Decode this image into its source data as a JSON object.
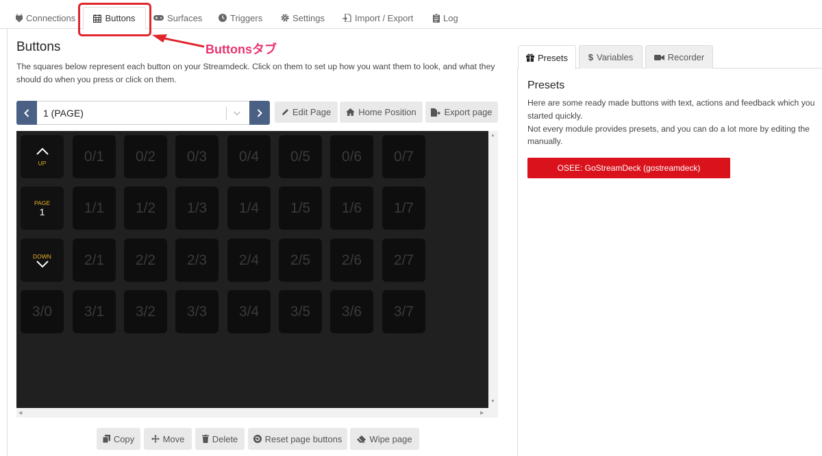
{
  "top_tabs": [
    {
      "label": "Connections",
      "icon": "plug-icon"
    },
    {
      "label": "Buttons",
      "icon": "calendar-grid-icon",
      "active": true
    },
    {
      "label": "Surfaces",
      "icon": "gamepad-icon"
    },
    {
      "label": "Triggers",
      "icon": "clock-icon"
    },
    {
      "label": "Settings",
      "icon": "gear-icon"
    },
    {
      "label": "Import / Export",
      "icon": "import-export-icon"
    },
    {
      "label": "Log",
      "icon": "clipboard-icon"
    }
  ],
  "annotation": {
    "label": "Buttonsタブ",
    "color": "#e8336d",
    "box_color": "#e0252b"
  },
  "buttons_panel": {
    "title": "Buttons",
    "description": "The squares below represent each button on your Streamdeck. Click on them to set up how you want them to look, and what they should do when you press or click on them.",
    "page_select": {
      "value": "1 (PAGE)"
    },
    "toolbar": {
      "edit_page": "Edit Page",
      "home_position": "Home Position",
      "export_page": "Export page"
    },
    "grid": {
      "rows": [
        [
          "UP",
          "0/1",
          "0/2",
          "0/3",
          "0/4",
          "0/5",
          "0/6",
          "0/7"
        ],
        [
          "PAGE",
          "1/1",
          "1/2",
          "1/3",
          "1/4",
          "1/5",
          "1/6",
          "1/7"
        ],
        [
          "DOWN",
          "2/1",
          "2/2",
          "2/3",
          "2/4",
          "2/5",
          "2/6",
          "2/7"
        ],
        [
          "3/0",
          "3/1",
          "3/2",
          "3/3",
          "3/4",
          "3/5",
          "3/6",
          "3/7"
        ]
      ],
      "page_number": "1"
    },
    "bottom_actions": {
      "copy": "Copy",
      "move": "Move",
      "delete": "Delete",
      "reset": "Reset page buttons",
      "wipe": "Wipe page"
    }
  },
  "right_panel": {
    "tabs": [
      {
        "label": "Presets",
        "icon": "gift-icon",
        "active": true
      },
      {
        "label": "Variables",
        "icon": "dollar-icon"
      },
      {
        "label": "Recorder",
        "icon": "video-camera-icon"
      }
    ],
    "title": "Presets",
    "desc_line1": "Here are some ready made buttons with text, actions and feedback which you",
    "desc_line2": "started quickly.",
    "desc_line3": "Not every module provides presets, and you can do a lot more by editing the",
    "desc_line4": "manually.",
    "preset_button": "OSEE: GoStreamDeck (gostreamdeck)",
    "preset_color": "#d9121c"
  },
  "colors": {
    "nav_label": "#e6b325",
    "pager_btn": "#4a6185",
    "grid_bg": "#202020"
  }
}
